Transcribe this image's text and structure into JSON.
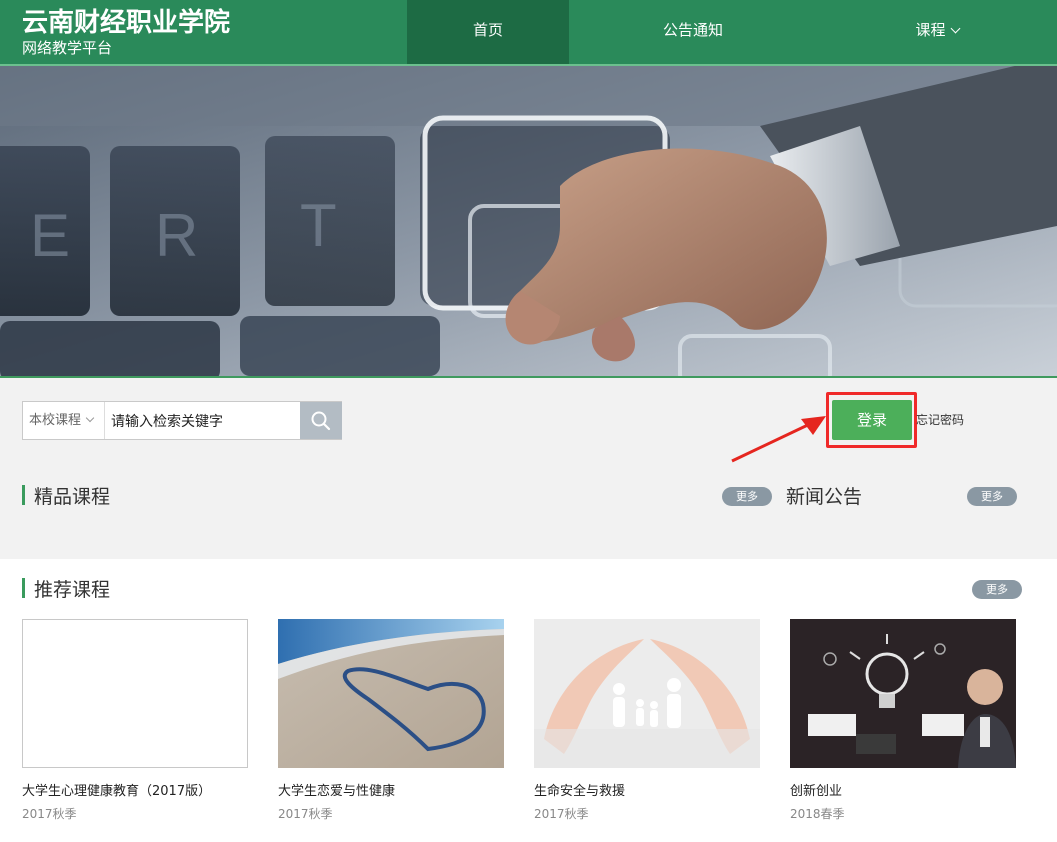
{
  "header": {
    "brand_title": "云南财经职业学院",
    "brand_subtitle": "网络教学平台",
    "nav": [
      "首页",
      "公告通知",
      "课程"
    ]
  },
  "search": {
    "type_label": "本校课程",
    "placeholder": "请输入检索关键字"
  },
  "auth": {
    "login_label": "登录",
    "forgot_label": "忘记密码"
  },
  "sections": {
    "featured_title": "精品课程",
    "news_title": "新闻公告",
    "recommended_title": "推荐课程",
    "more_label": "更多"
  },
  "courses": [
    {
      "name": "大学生心理健康教育（2017版）",
      "term": "2017秋季"
    },
    {
      "name": "大学生恋爱与性健康",
      "term": "2017秋季"
    },
    {
      "name": "生命安全与救援",
      "term": "2017秋季"
    },
    {
      "name": "创新创业",
      "term": "2018春季"
    }
  ],
  "colors": {
    "header": "#2a8a5a",
    "nav_active": "#1d6b44",
    "login": "#4caf5a",
    "highlight": "#f02a2a",
    "more_pill": "#8a98a3"
  },
  "icons": [
    "search-icon",
    "chevron-down-icon",
    "arrow-icon"
  ]
}
